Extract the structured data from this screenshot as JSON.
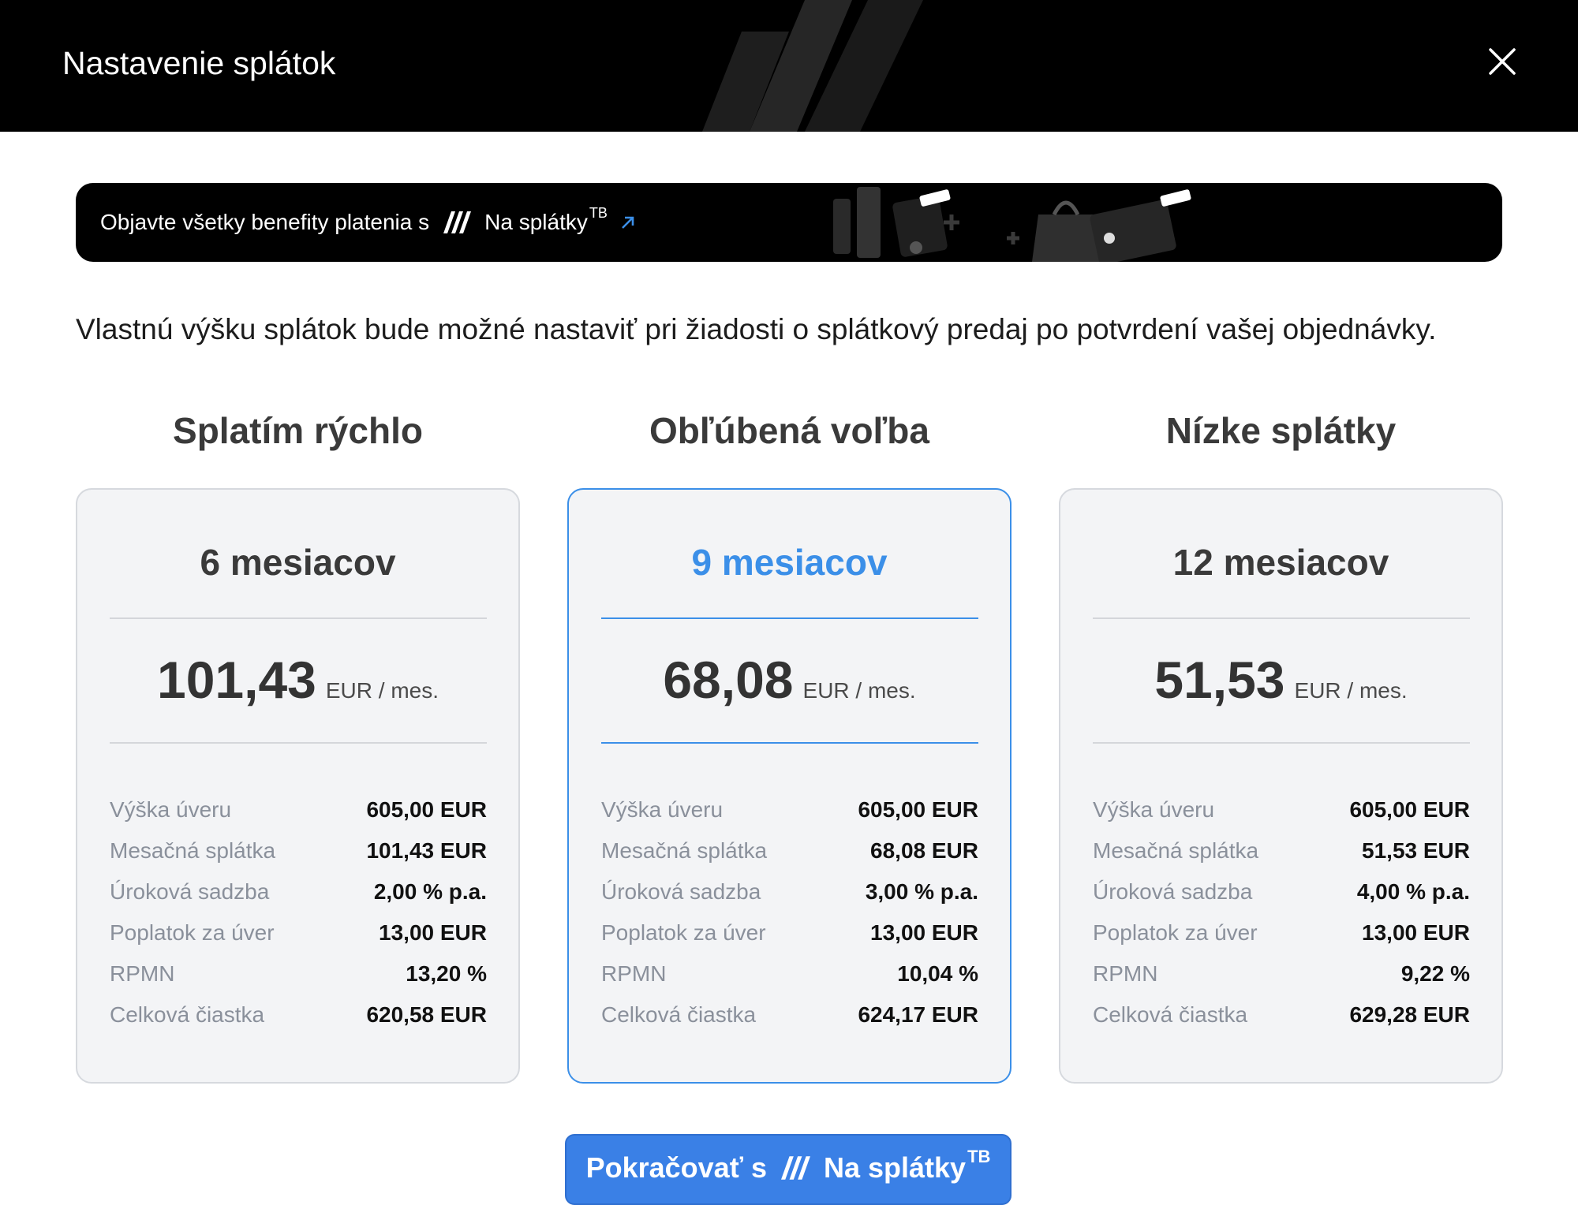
{
  "header": {
    "title": "Nastavenie splátok",
    "close_icon": "close-icon"
  },
  "banner": {
    "text": "Objavte všetky benefity platenia s",
    "brand": "Na splátky",
    "brand_sup": "TB",
    "link_icon": "arrow-up-right-icon"
  },
  "intro_text": "Vlastnú výšku splátok bude možné nastaviť pri žiadosti o splátkový predaj po potvrdení vašej objednávky.",
  "options": [
    {
      "title": "Splatím rýchlo",
      "months": "6 mesiacov",
      "price": "101,43",
      "unit": "EUR / mes.",
      "selected": false,
      "rows": [
        {
          "label": "Výška úveru",
          "value": "605,00 EUR"
        },
        {
          "label": "Mesačná splátka",
          "value": "101,43 EUR"
        },
        {
          "label": "Úroková sadzba",
          "value": "2,00 % p.a."
        },
        {
          "label": "Poplatok za úver",
          "value": "13,00 EUR"
        },
        {
          "label": "RPMN",
          "value": "13,20 %"
        },
        {
          "label": "Celková čiastka",
          "value": "620,58 EUR"
        }
      ]
    },
    {
      "title": "Obľúbená voľba",
      "months": "9 mesiacov",
      "price": "68,08",
      "unit": "EUR / mes.",
      "selected": true,
      "rows": [
        {
          "label": "Výška úveru",
          "value": "605,00 EUR"
        },
        {
          "label": "Mesačná splátka",
          "value": "68,08 EUR"
        },
        {
          "label": "Úroková sadzba",
          "value": "3,00 % p.a."
        },
        {
          "label": "Poplatok za úver",
          "value": "13,00 EUR"
        },
        {
          "label": "RPMN",
          "value": "10,04 %"
        },
        {
          "label": "Celková čiastka",
          "value": "624,17 EUR"
        }
      ]
    },
    {
      "title": "Nízke splátky",
      "months": "12 mesiacov",
      "price": "51,53",
      "unit": "EUR / mes.",
      "selected": false,
      "rows": [
        {
          "label": "Výška úveru",
          "value": "605,00 EUR"
        },
        {
          "label": "Mesačná splátka",
          "value": "51,53 EUR"
        },
        {
          "label": "Úroková sadzba",
          "value": "4,00 % p.a."
        },
        {
          "label": "Poplatok za úver",
          "value": "13,00 EUR"
        },
        {
          "label": "RPMN",
          "value": "9,22 %"
        },
        {
          "label": "Celková čiastka",
          "value": "629,28 EUR"
        }
      ]
    }
  ],
  "cta": {
    "prefix": "Pokračovať s",
    "brand": "Na splátky",
    "brand_sup": "TB"
  },
  "colors": {
    "accent": "#3b8fe8",
    "button": "#3a80e6",
    "header_bg": "#000000",
    "card_bg": "#f3f4f6"
  }
}
